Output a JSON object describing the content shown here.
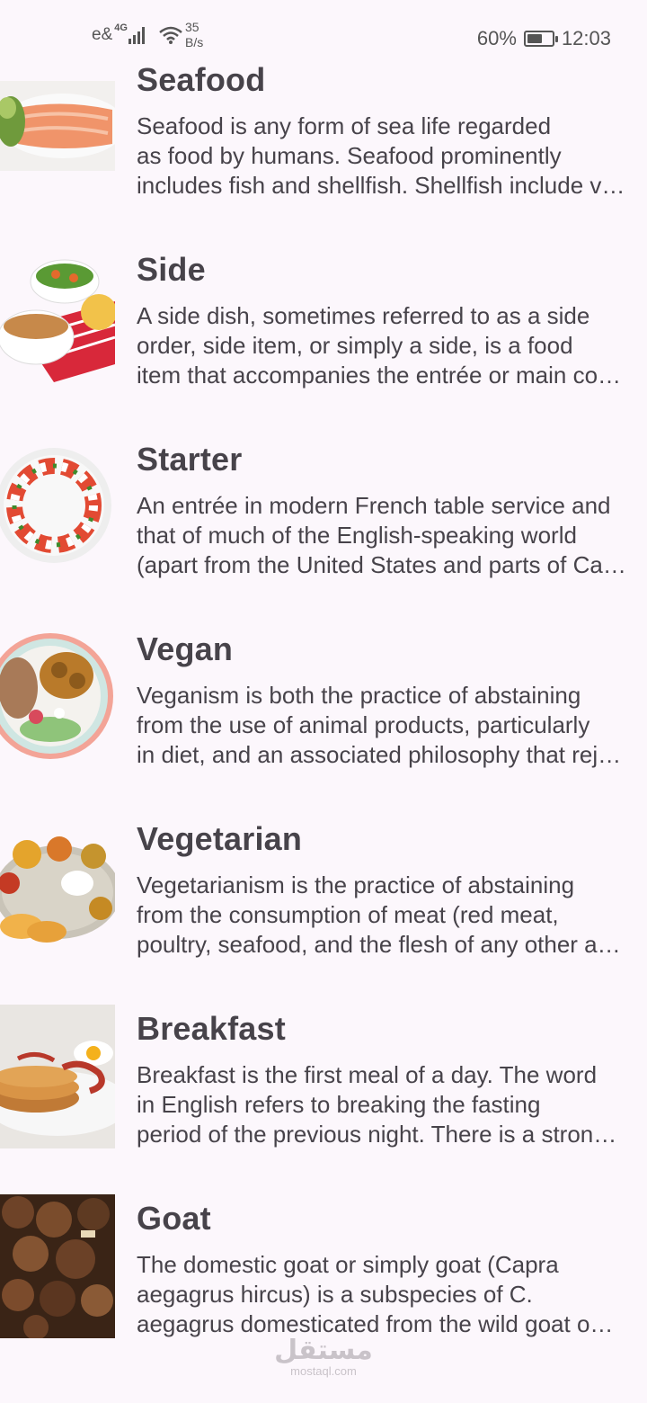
{
  "status_bar": {
    "carrier": "e&",
    "network": "4G",
    "speed_value": "35",
    "speed_unit": "B/s",
    "battery_text": "60%",
    "battery_level": 0.6,
    "time": "12:03"
  },
  "categories": [
    {
      "title": "Seafood",
      "thumb": "seafood-image",
      "lines": [
        "Seafood is any form of sea life regarded",
        "as food by humans. Seafood prominently",
        "includes fish and shellfish. Shellfish include v…"
      ]
    },
    {
      "title": "Side",
      "thumb": "side-dish-image",
      "lines": [
        "A side dish, sometimes referred to as a side",
        "order, side item, or simply a side, is a food",
        "item that accompanies the entrée or main co…"
      ]
    },
    {
      "title": "Starter",
      "thumb": "starter-image",
      "lines": [
        "An entrée in modern French table service and",
        "that of much of the English-speaking world",
        "(apart from the United States and parts of Ca…"
      ]
    },
    {
      "title": "Vegan",
      "thumb": "vegan-image",
      "lines": [
        "Veganism is both the practice of abstaining",
        "from the use of animal products, particularly",
        "in diet, and an associated philosophy that rej…"
      ]
    },
    {
      "title": "Vegetarian",
      "thumb": "vegetarian-image",
      "lines": [
        "Vegetarianism is the practice of abstaining",
        "from the consumption of meat (red meat,",
        "poultry, seafood, and the flesh of any other a…"
      ]
    },
    {
      "title": "Breakfast",
      "thumb": "breakfast-image",
      "lines": [
        "Breakfast is the first meal of a day. The word",
        "in English refers to breaking the fasting",
        "period of the previous night. There is a stron…"
      ]
    },
    {
      "title": "Goat",
      "thumb": "goat-image",
      "lines": [
        "The domestic goat or simply goat (Capra",
        "aegagrus hircus) is a subspecies of C.",
        "aegagrus domesticated from the wild goat o…"
      ]
    }
  ],
  "watermark": {
    "arabic": "مستقل",
    "latin": "mostaql.com"
  }
}
